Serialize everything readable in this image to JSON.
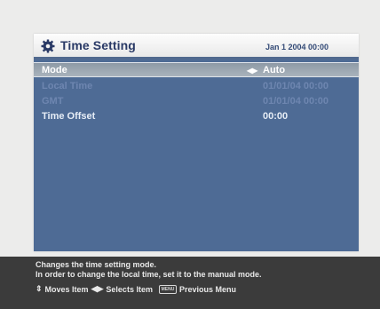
{
  "header": {
    "title": "Time Setting",
    "date": "Jan 1 2004 00:00",
    "icon": "gear-icon"
  },
  "rows": [
    {
      "label": "Mode",
      "value": "Auto",
      "state": "selected"
    },
    {
      "label": "Local Time",
      "value": "01/01/04 00:00",
      "state": "disabled"
    },
    {
      "label": "GMT",
      "value": "01/01/04 00:00",
      "state": "disabled"
    },
    {
      "label": "Time Offset",
      "value": "00:00",
      "state": "normal"
    }
  ],
  "footer": {
    "help_line1": "Changes the time setting mode.",
    "help_line2": "In order to change the local time, set it to the manual mode.",
    "nav_move": "Moves Item",
    "nav_select": "Selects Item",
    "nav_menu_key": "MENU",
    "nav_previous": "Previous Menu"
  },
  "colors": {
    "panel": "#4e6b95",
    "selected_row": "#9ea9b4",
    "footer": "#3b3b3b"
  }
}
